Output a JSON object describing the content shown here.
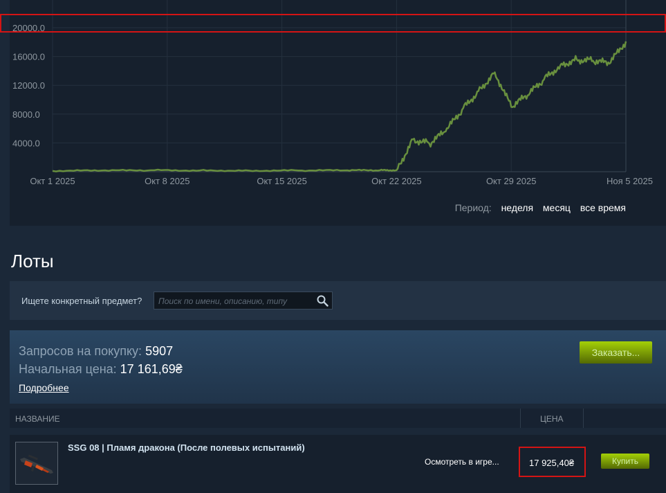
{
  "chart": {
    "y_ticks": [
      "20000.0",
      "16000.0",
      "12000.0",
      "8000.0",
      "4000.0"
    ],
    "x_ticks": [
      "Окт 1 2025",
      "Окт 8 2025",
      "Окт 15 2025",
      "Окт 22 2025",
      "Окт 29 2025",
      "Ноя 5 2025"
    ],
    "line_color": "#688f3e"
  },
  "chart_data": {
    "type": "line",
    "title": "",
    "xlabel": "",
    "ylabel": "",
    "ylim": [
      0,
      20000
    ],
    "xlim": [
      "2025-10-01",
      "2025-11-05"
    ],
    "grid": true,
    "series": [
      {
        "x": [
          "2025-10-01",
          "2025-10-04",
          "2025-10-07",
          "2025-10-10",
          "2025-10-13",
          "2025-10-16",
          "2025-10-19",
          "2025-10-21",
          "2025-10-22",
          "2025-10-23",
          "2025-10-24",
          "2025-10-25",
          "2025-10-26",
          "2025-10-27",
          "2025-10-28",
          "2025-10-29",
          "2025-10-30",
          "2025-10-31",
          "2025-11-01",
          "2025-11-02",
          "2025-11-03",
          "2025-11-04",
          "2025-11-05"
        ],
        "values": [
          120,
          160,
          200,
          180,
          150,
          170,
          190,
          200,
          210,
          4500,
          3900,
          5600,
          8600,
          11200,
          13800,
          9000,
          10600,
          12800,
          14800,
          15600,
          15400,
          15000,
          18100
        ]
      }
    ]
  },
  "period": {
    "label": "Период:",
    "options": [
      "неделя",
      "месяц",
      "все время"
    ]
  },
  "lots": {
    "title": "Лоты"
  },
  "search": {
    "label": "Ищете конкретный предмет?",
    "placeholder": "Поиск по имени, описанию, типу"
  },
  "buy_orders": {
    "requests_label": "Запросов на покупку:",
    "requests_value": "5907",
    "start_price_label": "Начальная цена:",
    "start_price_value": "17 161,69₴",
    "details_link": "Подробнее",
    "order_button": "Заказать..."
  },
  "table": {
    "col_name": "НАЗВАНИЕ",
    "col_price": "ЦЕНА"
  },
  "listing": {
    "name": "SSG 08 | Пламя дракона (После полевых испытаний)",
    "inspect": "Осмотреть в игре...",
    "price": "17 925,40₴",
    "buy_button": "Купить"
  },
  "colors": {
    "highlight": "#d41414",
    "button_green": "#a4d007"
  }
}
